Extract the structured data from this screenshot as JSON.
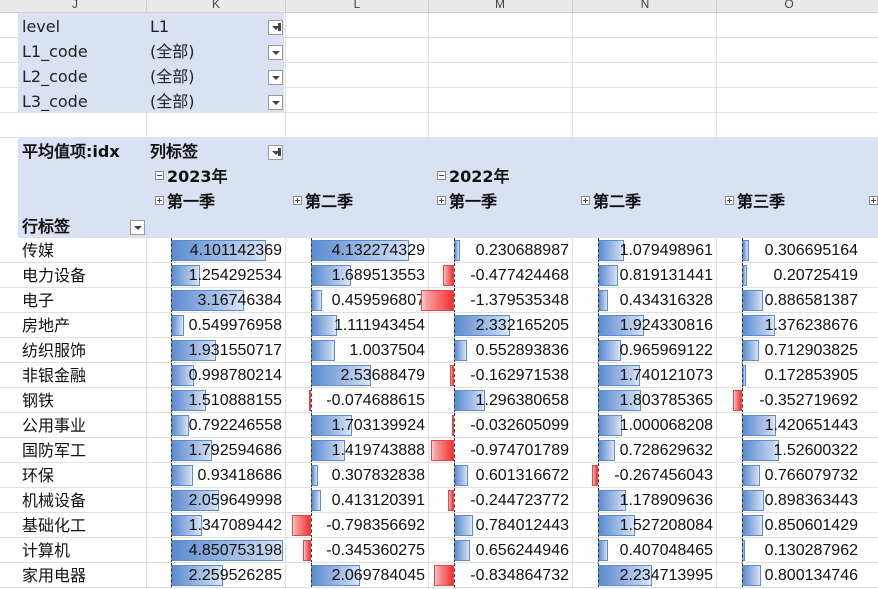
{
  "column_headers": [
    "J",
    "K",
    "L",
    "M",
    "N",
    "O"
  ],
  "filters": [
    {
      "name": "level",
      "value": "L1"
    },
    {
      "name": "L1_code",
      "value": "(全部)"
    },
    {
      "name": "L2_code",
      "value": "(全部)"
    },
    {
      "name": "L3_code",
      "value": "(全部)"
    }
  ],
  "pivot": {
    "value_field": "平均值项:idx",
    "col_labels": "列标签",
    "row_labels": "行标签",
    "years": [
      "2023年",
      "2022年"
    ],
    "quarters": [
      "第一季",
      "第二季",
      "第一季",
      "第二季",
      "第三季"
    ]
  },
  "rows": [
    {
      "label": "传媒",
      "values": [
        4.101142369,
        4.132274329,
        0.230688987,
        1.079498961,
        0.306695164
      ],
      "text": [
        "4.101142369",
        "4.132274329",
        "0.230688987",
        "1.079498961",
        "0.306695164"
      ]
    },
    {
      "label": "电力设备",
      "values": [
        1.254292534,
        1.689513553,
        -0.477424468,
        0.819131441,
        0.20725419
      ],
      "text": [
        "1.254292534",
        "1.689513553",
        "-0.477424468",
        "0.819131441",
        "0.20725419"
      ]
    },
    {
      "label": "电子",
      "values": [
        3.16746384,
        0.459596807,
        -1.379535348,
        0.434316328,
        0.886581387
      ],
      "text": [
        "3.16746384",
        "0.459596807",
        "-1.379535348",
        "0.434316328",
        "0.886581387"
      ]
    },
    {
      "label": "房地产",
      "values": [
        0.549976958,
        1.111943454,
        2.332165205,
        1.924330816,
        1.376238676
      ],
      "text": [
        "0.549976958",
        "1.111943454",
        "2.332165205",
        "1.924330816",
        "1.376238676"
      ]
    },
    {
      "label": "纺织服饰",
      "values": [
        1.931550717,
        1.0037504,
        0.552893836,
        0.965969122,
        0.712903825
      ],
      "text": [
        "1.931550717",
        "1.0037504",
        "0.552893836",
        "0.965969122",
        "0.712903825"
      ]
    },
    {
      "label": "非银金融",
      "values": [
        0.998780214,
        2.53688479,
        -0.162971538,
        1.740121073,
        0.172853905
      ],
      "text": [
        "0.998780214",
        "2.53688479",
        "-0.162971538",
        "1.740121073",
        "0.172853905"
      ]
    },
    {
      "label": "钢铁",
      "values": [
        1.510888155,
        -0.074688615,
        1.296380658,
        1.803785365,
        -0.352719692
      ],
      "text": [
        "1.510888155",
        "-0.074688615",
        "1.296380658",
        "1.803785365",
        "-0.352719692"
      ]
    },
    {
      "label": "公用事业",
      "values": [
        0.792246558,
        1.703139924,
        -0.032605099,
        1.000068208,
        1.420651443
      ],
      "text": [
        "0.792246558",
        "1.703139924",
        "-0.032605099",
        "1.000068208",
        "1.420651443"
      ]
    },
    {
      "label": "国防军工",
      "values": [
        1.792594686,
        1.419743888,
        -0.974701789,
        0.728629632,
        1.52600322
      ],
      "text": [
        "1.792594686",
        "1.419743888",
        "-0.974701789",
        "0.728629632",
        "1.52600322"
      ]
    },
    {
      "label": "环保",
      "values": [
        0.93418686,
        0.307832838,
        0.601316672,
        -0.267456043,
        0.766079732
      ],
      "text": [
        "0.93418686",
        "0.307832838",
        "0.601316672",
        "-0.267456043",
        "0.766079732"
      ]
    },
    {
      "label": "机械设备",
      "values": [
        2.059649998,
        0.413120391,
        -0.244723772,
        1.178909636,
        0.898363443
      ],
      "text": [
        "2.059649998",
        "0.413120391",
        "-0.244723772",
        "1.178909636",
        "0.898363443"
      ]
    },
    {
      "label": "基础化工",
      "values": [
        1.347089442,
        -0.798356692,
        0.784012443,
        1.527208084,
        0.850601429
      ],
      "text": [
        "1.347089442",
        "-0.798356692",
        "0.784012443",
        "1.527208084",
        "0.850601429"
      ]
    },
    {
      "label": "计算机",
      "values": [
        4.850753198,
        -0.345360275,
        0.656244946,
        0.407048465,
        0.130287962
      ],
      "text": [
        "4.850753198",
        "-0.345360275",
        "0.656244946",
        "0.407048465",
        "0.130287962"
      ]
    },
    {
      "label": "家用电器",
      "values": [
        2.259526285,
        2.069784045,
        -0.834864732,
        2.234713995,
        0.800134746
      ],
      "text": [
        "2.259526285",
        "2.069784045",
        "-0.834864732",
        "2.234713995",
        "0.800134746"
      ]
    }
  ],
  "colors": {
    "header_fill": "#d9e1f2",
    "bar_positive": "#5b8bd0",
    "bar_negative": "#f03232"
  }
}
